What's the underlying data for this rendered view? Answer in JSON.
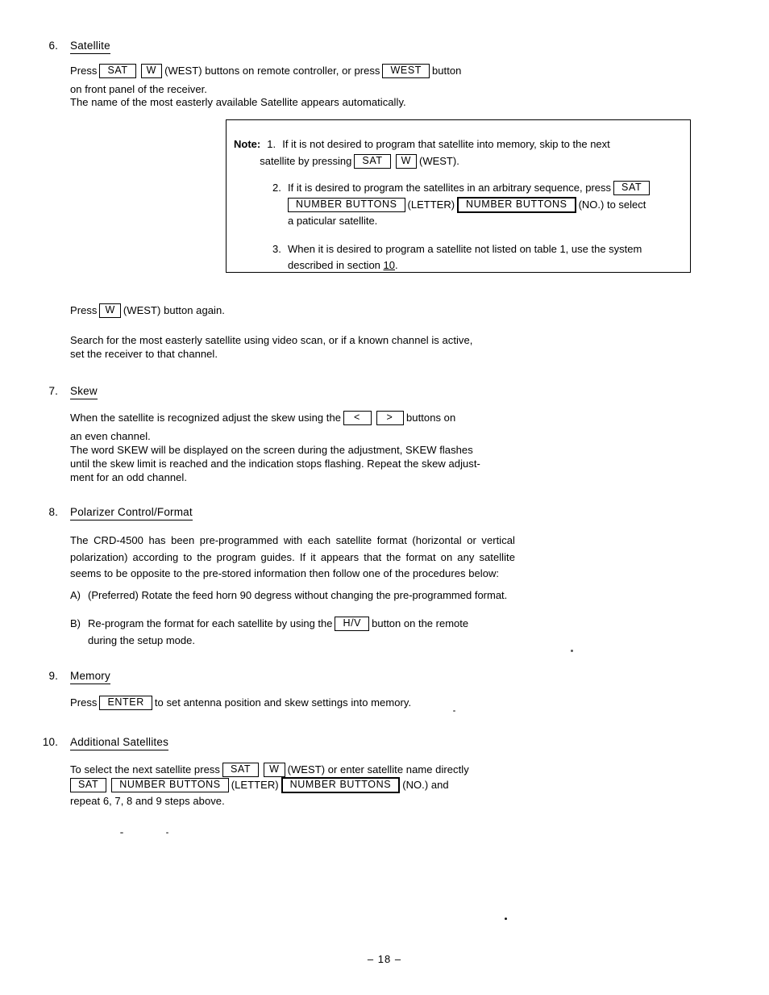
{
  "document": {
    "page_number": "– 18 –"
  },
  "sections": {
    "satellite": {
      "number": "6.",
      "heading": "Satellite",
      "line1_a": "Press",
      "key_sat": "SAT",
      "key_w": "W",
      "line1_b": "(WEST) buttons on remote controller, or press",
      "key_west": "WEST",
      "line1_c": "button",
      "line2": "on front panel of the receiver.",
      "line3": "The name of the most easterly available Satellite appears automatically.",
      "press_again_a": "Press",
      "press_again_key": "W",
      "press_again_b": "(WEST) button again.",
      "search_line1": "Search for the most easterly satellite using video scan, or if a known channel is active,",
      "search_line2": "set the receiver to that channel."
    },
    "note": {
      "label": "Note:",
      "items": [
        {
          "index": "1.",
          "text_a": "If it is not desired to program that satellite into memory, skip to the next",
          "text_b": "satellite by pressing",
          "key1": "SAT",
          "key2": "W",
          "text_c": "(WEST)."
        },
        {
          "index": "2.",
          "text_a": "If it is desired to program the satellites in an arbitrary sequence, press",
          "key1": "SAT",
          "key2": "NUMBER BUTTONS",
          "text_b": "(LETTER)",
          "key3": "NUMBER BUTTONS",
          "text_c": "(NO.) to select",
          "text_d": "a paticular satellite."
        },
        {
          "index": "3.",
          "text_a": "When it is desired to program a satellite not listed on table 1, use the system",
          "text_b": "described in section",
          "text_ref": "10",
          "text_c": "."
        }
      ]
    },
    "skew": {
      "number": "7.",
      "heading": "Skew",
      "line1_a": "When the satellite is recognized adjust the skew using the",
      "key_left": "<",
      "key_right": ">",
      "line1_b": "buttons on",
      "line2": "an even channel.",
      "line3": "The word SKEW will be displayed on the screen during the adjustment, SKEW flashes",
      "line4": "until the skew limit is reached and the indication stops flashing. Repeat the skew adjust-",
      "line5": "ment for an odd channel."
    },
    "polarizer": {
      "number": "8.",
      "heading": "Polarizer Control/Format",
      "body": "The CRD-4500 has been pre-programmed with each satellite format (horizontal or vertical polarization) according to the program guides. If it appears that the format on any satellite seems to be opposite to the pre-stored information then follow one of the procedures below:",
      "items": [
        {
          "label": "A)",
          "text": "(Preferred) Rotate the feed horn 90 degress without changing the pre-programmed format."
        },
        {
          "label": "B)",
          "text_a": "Re-program the format for each satellite by using the",
          "key": "H/V",
          "text_b": "button on the remote",
          "text_c": "during the setup mode."
        }
      ]
    },
    "memory": {
      "number": "9.",
      "heading": "Memory",
      "line_a": "Press",
      "key_enter": "ENTER",
      "line_b": "to set antenna position and skew settings into memory."
    },
    "additional": {
      "number": "10.",
      "heading": "Additional Satellites",
      "line1_a": "To select the next satellite press",
      "key_sat1": "SAT",
      "key_w": "W",
      "line1_b": "(WEST) or enter satellite name directly",
      "key_sat2": "SAT",
      "key_num1": "NUMBER BUTTONS",
      "line2_a": "(LETTER)",
      "key_num2": "NUMBER BUTTONS",
      "line2_b": "(NO.)  and",
      "line3": "repeat 6, 7, 8 and 9 steps above."
    }
  }
}
